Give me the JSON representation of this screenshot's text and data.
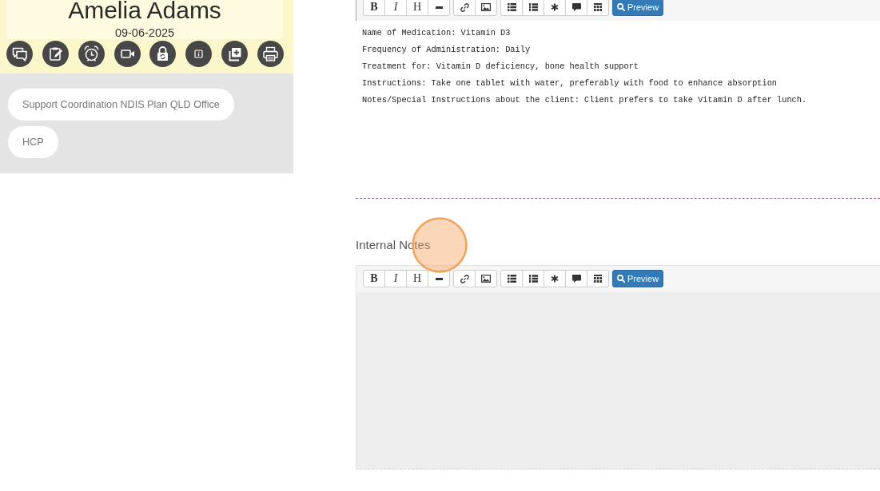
{
  "profile": {
    "name": "Amelia Adams",
    "date": "09-06-2025"
  },
  "tags": [
    "Support Coordination NDIS Plan QLD Office",
    "HCP"
  ],
  "editors": [
    {
      "focused": true,
      "disabled": false,
      "click_highlight": false,
      "toolbar": {
        "groups": [
          [
            {
              "kind": "bold",
              "label": "B"
            },
            {
              "kind": "italic",
              "label": "I"
            },
            {
              "kind": "plain",
              "label": "H"
            },
            {
              "kind": "icon"
            }
          ],
          [
            {
              "kind": "icon"
            },
            {
              "kind": "icon"
            }
          ],
          [
            {
              "kind": "icon"
            },
            {
              "kind": "icon"
            },
            {
              "kind": "icon"
            },
            {
              "kind": "icon"
            },
            {
              "kind": "icon"
            }
          ]
        ],
        "preview": "Preview"
      },
      "value": "Name of Medication: Vitamin D3\nFrequency of Administration: Daily\nTreatment for: Vitamin D deficiency, bone health support\nInstructions: Take one tablet with water, preferably with food to enhance absorption\nNotes/Special Instructions about the client: Client prefers to take Vitamin D after lunch."
    },
    {
      "label": "Internal Notes",
      "focused": false,
      "disabled": true,
      "click_highlight": true,
      "toolbar": {
        "groups": [
          [
            {
              "kind": "bold",
              "label": "B"
            },
            {
              "kind": "italic",
              "label": "I"
            },
            {
              "kind": "plain",
              "label": "H"
            },
            {
              "kind": "icon"
            }
          ],
          [
            {
              "kind": "icon"
            },
            {
              "kind": "icon"
            }
          ],
          [
            {
              "kind": "icon"
            },
            {
              "kind": "icon"
            },
            {
              "kind": "icon"
            },
            {
              "kind": "icon"
            },
            {
              "kind": "icon"
            }
          ]
        ],
        "preview": "Preview"
      }
    }
  ]
}
